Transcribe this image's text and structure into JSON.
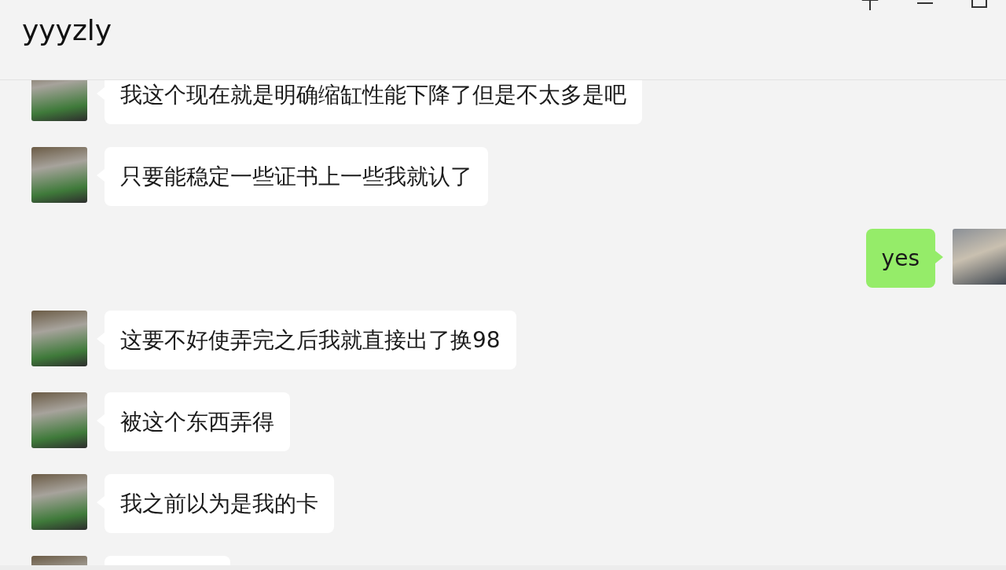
{
  "window": {
    "title": "yyyzly"
  },
  "messages": [
    {
      "kind": "incoming",
      "text": "我这个现在就是明确缩缸性能下降了但是不太多是吧"
    },
    {
      "kind": "incoming",
      "text": "只要能稳定一些证书上一些我就认了"
    },
    {
      "kind": "outgoing",
      "text": "yes"
    },
    {
      "kind": "incoming",
      "text": "这要不好使弄完之后我就直接出了换98"
    },
    {
      "kind": "incoming",
      "text": "被这个东西弄得"
    },
    {
      "kind": "incoming",
      "text": "我之前以为是我的卡"
    },
    {
      "kind": "incoming"
    }
  ]
}
